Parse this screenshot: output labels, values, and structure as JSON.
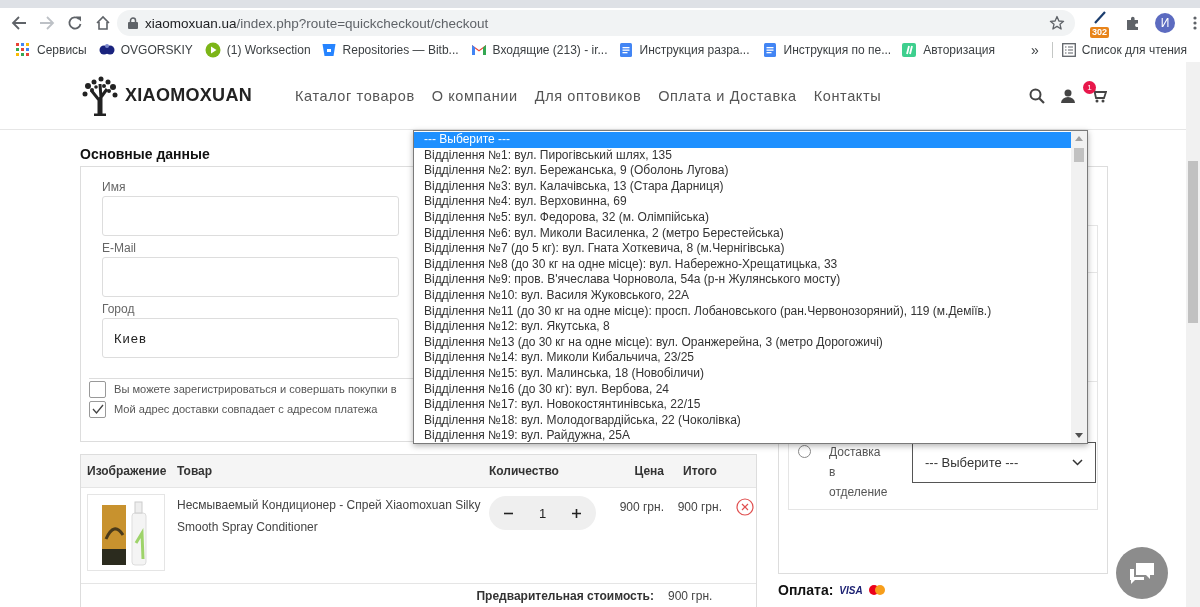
{
  "browser": {
    "url_host": "xiaomoxuan.ua",
    "url_path": "/index.php?route=quickcheckout/checkout",
    "extension_badge": "302",
    "profile_initial": "И",
    "bookmarks": [
      {
        "label": "Сервисы",
        "kind": "apps"
      },
      {
        "label": "OVGORSKIY",
        "kind": "logo"
      },
      {
        "label": "(1) Worksection",
        "kind": "play"
      },
      {
        "label": "Repositories — Bitb...",
        "kind": "bucket"
      },
      {
        "label": "Входящие (213) - ir...",
        "kind": "mail"
      },
      {
        "label": "Инструкция разра...",
        "kind": "doc"
      },
      {
        "label": "Инструкция по пе...",
        "kind": "doc"
      },
      {
        "label": "Авторизация",
        "kind": "slash"
      }
    ],
    "more": "»",
    "reading_list": "Список для чтения"
  },
  "header": {
    "logo": "XIAOMOXUAN",
    "nav": [
      "Каталог товаров",
      "О компании",
      "Для оптовиков",
      "Оплата и Доставка",
      "Контакты"
    ],
    "cart_count": "1"
  },
  "main_data": {
    "title": "Основные данные",
    "fields": [
      {
        "label": "Имя"
      },
      {
        "label": "E-Mail"
      },
      {
        "label": "Город",
        "value": "Киев"
      }
    ],
    "checkboxes": [
      {
        "label": "Вы можете зарегистрироваться и совершать покупки в",
        "checked": false
      },
      {
        "label": "Мой адрес доставки совпадает с адресом платежа",
        "checked": true
      }
    ]
  },
  "cart": {
    "columns": [
      "Изображение",
      "Товар",
      "Количество",
      "Цена",
      "Итого"
    ],
    "rows": [
      {
        "name": "Несмываемый Кондиционер - Спрей Xiaomoxuan Silky Smooth Spray Conditioner",
        "quantity": "1",
        "price": "900 грн.",
        "total": "900 грн."
      }
    ],
    "subtotal_label": "Предварительная стоимость:",
    "subtotal": "900 грн."
  },
  "delivery": {
    "option_words": [
      "Доставка",
      "в",
      "отделение"
    ],
    "selected": false,
    "select_value": "--- Выберите ---"
  },
  "payment": {
    "label": "Оплата:",
    "card_logo": "VISA"
  },
  "dropdown": {
    "options": [
      {
        "label": "--- Выберите ---",
        "selected": true
      },
      {
        "label": "Відділення №1: вул. Пирогівський шлях, 135",
        "selected": false
      },
      {
        "label": "Відділення №2: вул. Бережанська, 9 (Оболонь Лугова)",
        "selected": false
      },
      {
        "label": "Відділення №3: вул. Калачівська, 13 (Стара Дарниця)",
        "selected": false
      },
      {
        "label": "Відділення №4: вул. Верховинна, 69",
        "selected": false
      },
      {
        "label": "Відділення №5: вул. Федорова, 32 (м. Олімпійська)",
        "selected": false
      },
      {
        "label": "Відділення №6: вул. Миколи Василенка, 2 (метро Берестейська)",
        "selected": false
      },
      {
        "label": "Відділення №7 (до 5 кг): вул. Гната Хоткевича, 8 (м.Чернігівська)",
        "selected": false
      },
      {
        "label": "Відділення №8 (до 30 кг на одне місце): вул. Набережно-Хрещатицька, 33",
        "selected": false
      },
      {
        "label": "Відділення №9: пров. В'ячеслава Чорновола, 54а (р-н Жулянського мосту)",
        "selected": false
      },
      {
        "label": "Відділення №10: вул. Василя Жуковського, 22А",
        "selected": false
      },
      {
        "label": "Відділення №11 (до 30 кг на одне місце): просп. Лобановського (ран.Червонозоряний), 119 (м.Деміїв.)",
        "selected": false
      },
      {
        "label": "Відділення №12: вул. Якутська, 8",
        "selected": false
      },
      {
        "label": "Відділення №13 (до 30 кг на одне місце): вул. Оранжерейна, 3 (метро Дорогожичі)",
        "selected": false
      },
      {
        "label": "Відділення №14: вул. Миколи Кибальчича, 23/25",
        "selected": false
      },
      {
        "label": "Відділення №15: вул. Малинська, 18 (Новобіличи)",
        "selected": false
      },
      {
        "label": "Відділення №16 (до 30 кг): вул. Вербова, 24",
        "selected": false
      },
      {
        "label": "Відділення №17: вул. Новокостянтинівська, 22/15",
        "selected": false
      },
      {
        "label": "Відділення №18: вул. Молодогвардійська, 22 (Чоколівка)",
        "selected": false
      },
      {
        "label": "Відділення №19: вул. Райдужна, 25А",
        "selected": false
      }
    ]
  }
}
